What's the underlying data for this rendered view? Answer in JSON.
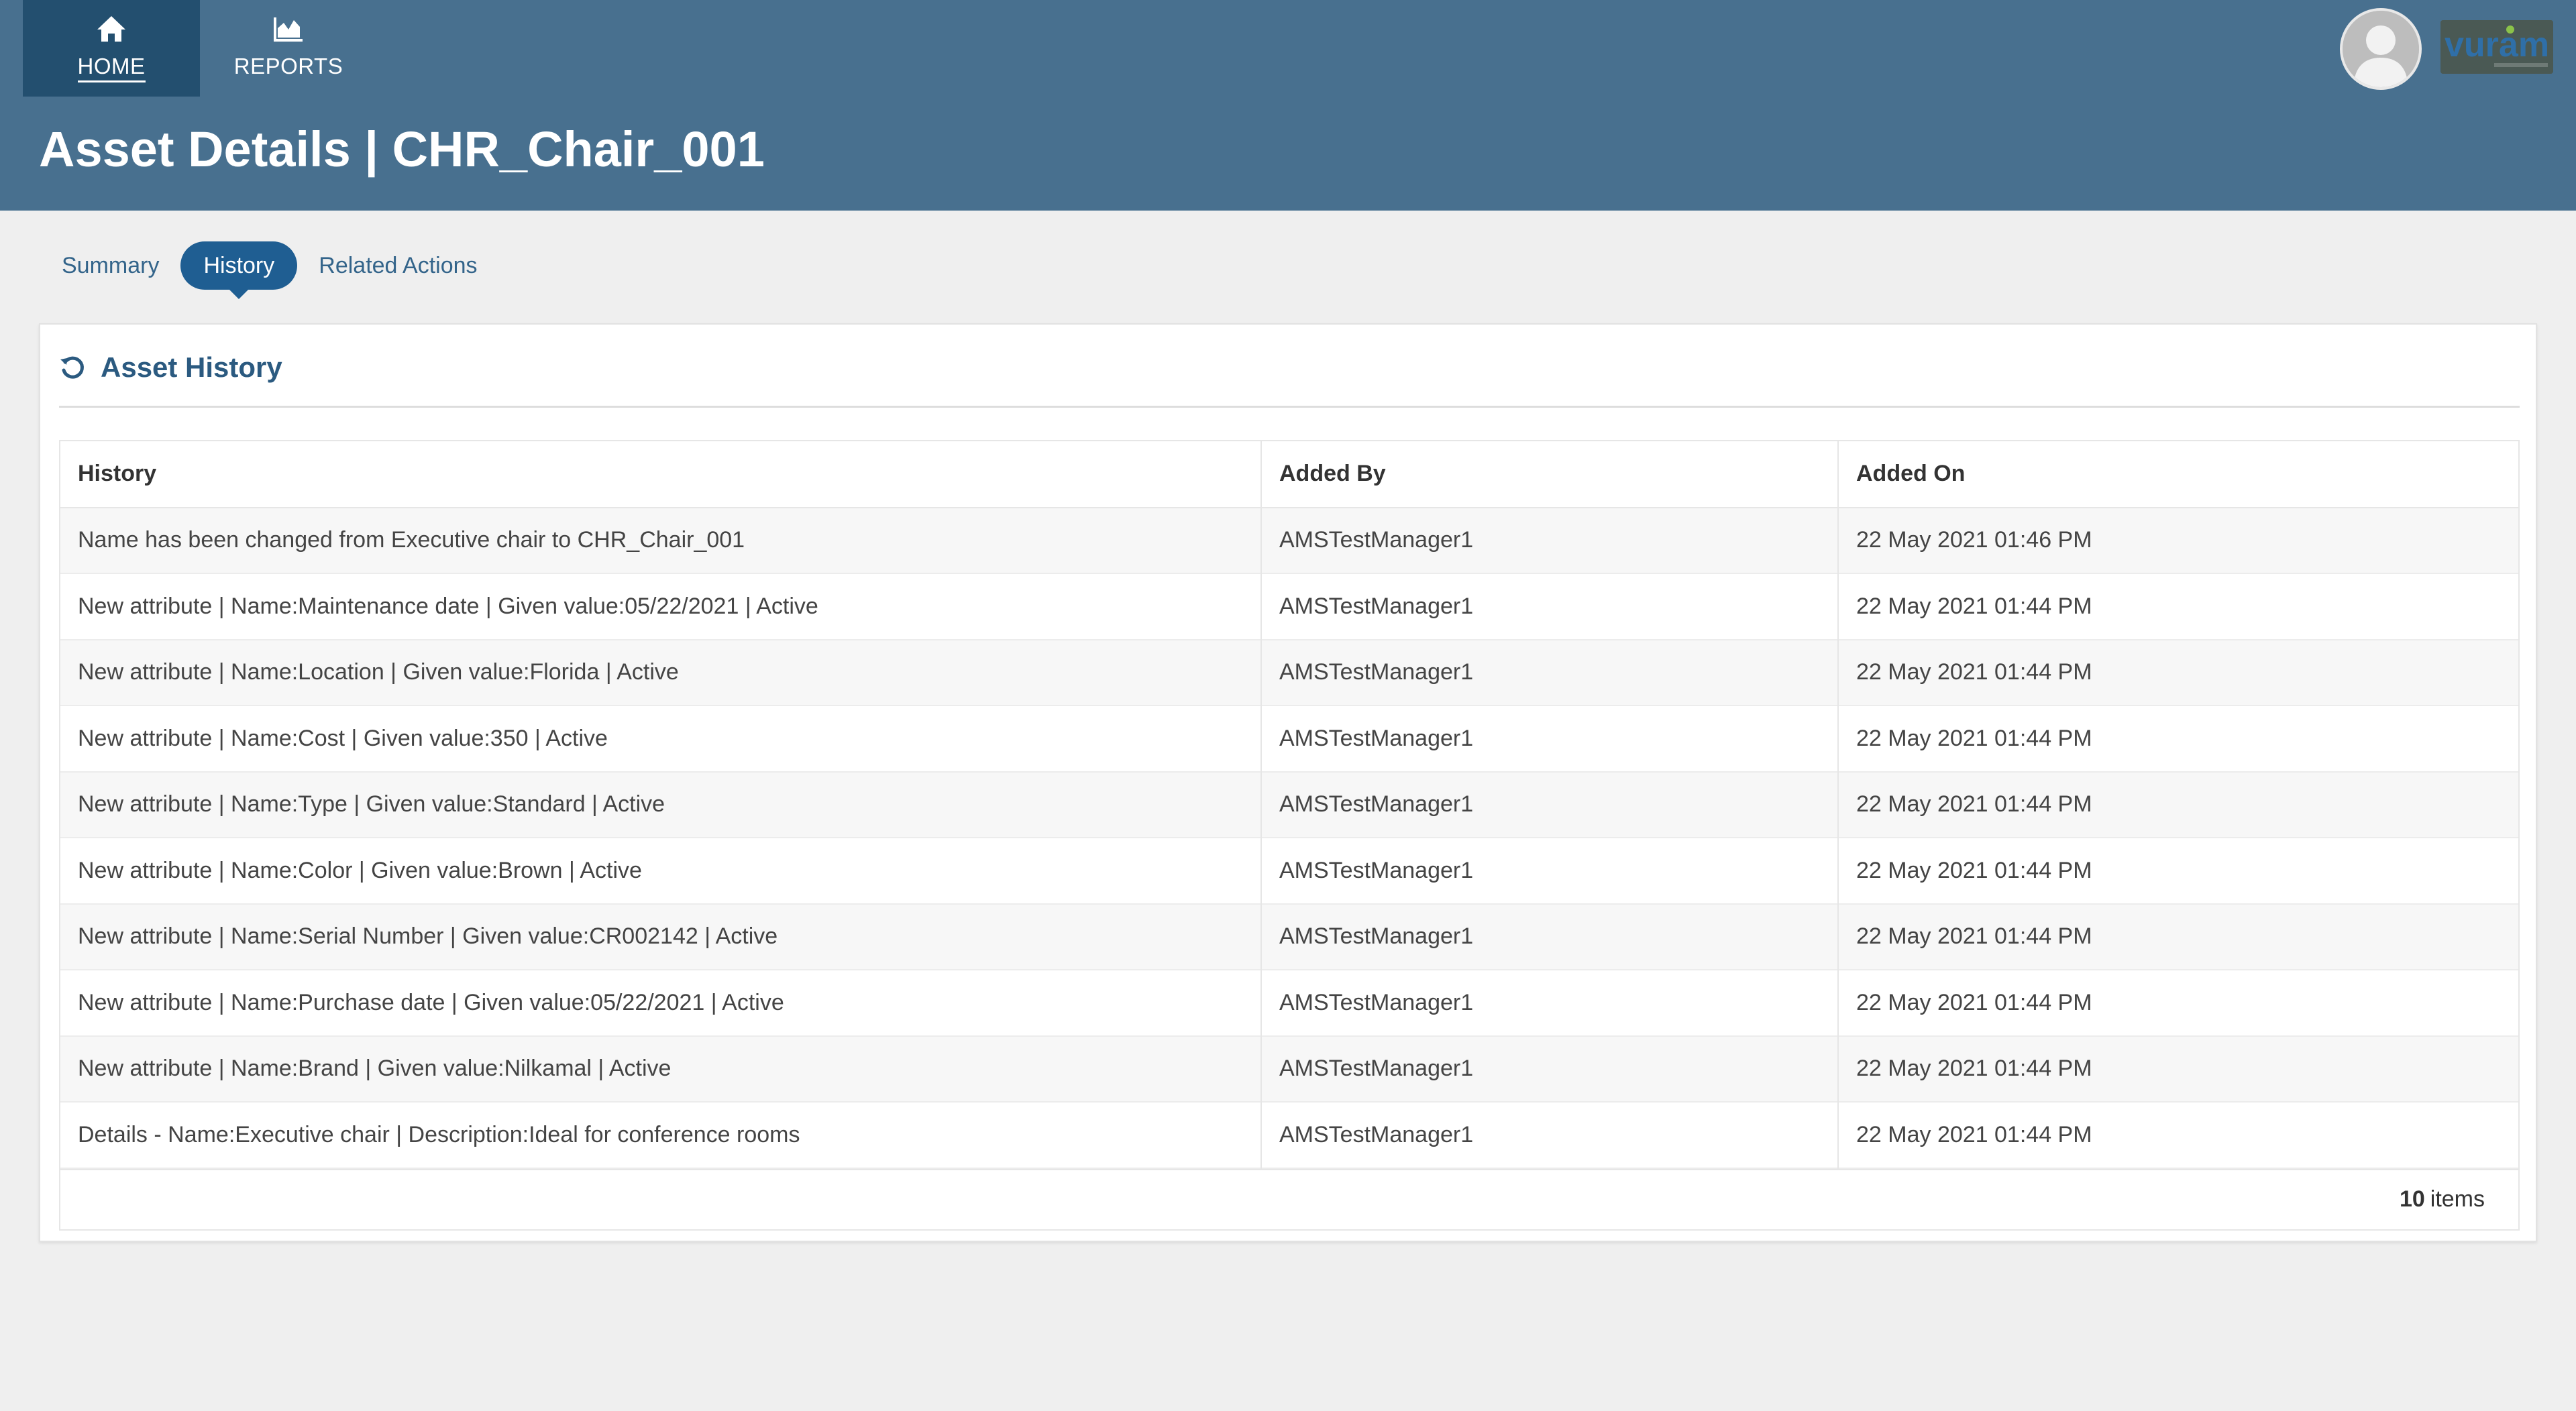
{
  "nav": {
    "home_label": "HOME",
    "home_icon": "home-icon",
    "reports_label": "REPORTS",
    "reports_icon": "chart-area-icon"
  },
  "header": {
    "title": "Asset Details | CHR_Chair_001",
    "brand_logo_text": "vuram"
  },
  "tabs": [
    {
      "label": "Summary",
      "active": false
    },
    {
      "label": "History",
      "active": true
    },
    {
      "label": "Related Actions",
      "active": false
    }
  ],
  "panel": {
    "title": "Asset History",
    "icon": "history-icon"
  },
  "table": {
    "columns": [
      "History",
      "Added By",
      "Added On"
    ],
    "rows": [
      [
        "Name has been changed from Executive chair to CHR_Chair_001",
        "AMSTestManager1",
        "22 May 2021 01:46 PM"
      ],
      [
        "New attribute | Name:Maintenance date | Given value:05/22/2021 | Active",
        "AMSTestManager1",
        "22 May 2021 01:44 PM"
      ],
      [
        "New attribute | Name:Location | Given value:Florida | Active",
        "AMSTestManager1",
        "22 May 2021 01:44 PM"
      ],
      [
        "New attribute | Name:Cost | Given value:350 | Active",
        "AMSTestManager1",
        "22 May 2021 01:44 PM"
      ],
      [
        "New attribute | Name:Type | Given value:Standard | Active",
        "AMSTestManager1",
        "22 May 2021 01:44 PM"
      ],
      [
        "New attribute | Name:Color | Given value:Brown | Active",
        "AMSTestManager1",
        "22 May 2021 01:44 PM"
      ],
      [
        "New attribute | Name:Serial Number | Given value:CR002142 | Active",
        "AMSTestManager1",
        "22 May 2021 01:44 PM"
      ],
      [
        "New attribute | Name:Purchase date | Given value:05/22/2021 | Active",
        "AMSTestManager1",
        "22 May 2021 01:44 PM"
      ],
      [
        "New attribute | Name:Brand | Given value:Nilkamal | Active",
        "AMSTestManager1",
        "22 May 2021 01:44 PM"
      ],
      [
        "Details - Name:Executive chair | Description:Ideal for conference rooms",
        "AMSTestManager1",
        "22 May 2021 01:44 PM"
      ]
    ],
    "footer": {
      "count": "10",
      "unit": "items"
    }
  },
  "colors": {
    "header_bg": "#48708f",
    "nav_active_bg": "#234f6f",
    "tab_active_bg": "#1f5e92",
    "link": "#33648a",
    "panel_title": "#2b5a80"
  }
}
